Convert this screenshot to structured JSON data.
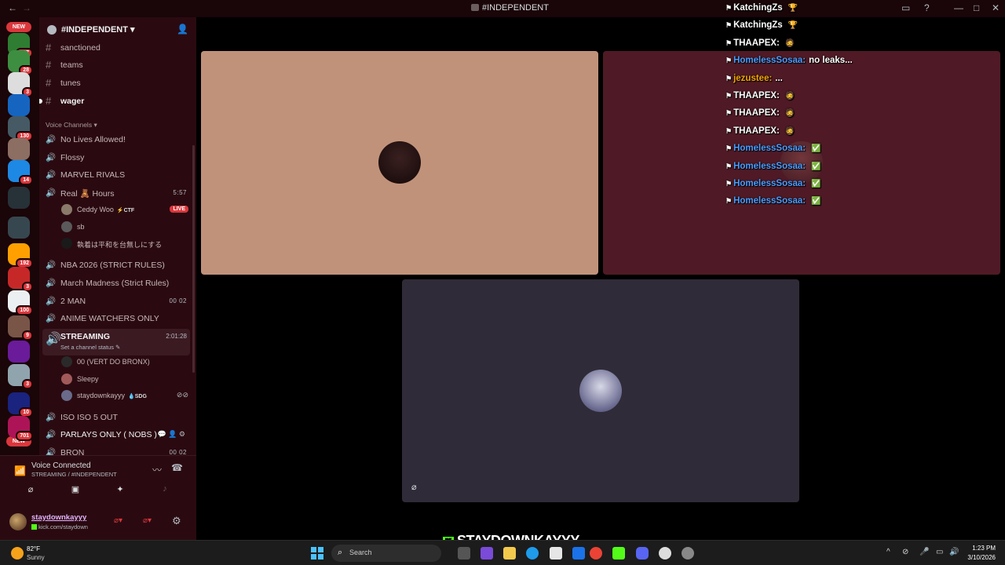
{
  "titlebar": {
    "title": "#INDEPENDENT",
    "back_icon": "arrow-left-icon",
    "forward_icon": "arrow-right-icon"
  },
  "servers": {
    "new_label": "NEW",
    "counts": [
      "437",
      "28",
      "3",
      "",
      "130",
      "",
      "14",
      "",
      "",
      "192",
      "3",
      "100",
      "9",
      "",
      "3",
      "10",
      "701"
    ]
  },
  "guild": {
    "name": "#INDEPENDENT",
    "text_channels": [
      "sanctioned",
      "teams",
      "tunes",
      "wager"
    ],
    "voice_section": "Voice Channels",
    "voice_channels": [
      {
        "name": "No Lives Allowed!"
      },
      {
        "name": "Flossy"
      },
      {
        "name": "MARVEL RIVALS"
      },
      {
        "name": "Real 🧸 Hours",
        "time": "5:57"
      },
      {
        "name": "NBA 2026 (STRICT RULES)"
      },
      {
        "name": "March Madness (Strict Rules)"
      },
      {
        "name": "2 MAN",
        "time": "00 02"
      },
      {
        "name": "ANIME WATCHERS ONLY"
      },
      {
        "name": "STREAMING",
        "time": "2:01:28",
        "status": "Set a channel status"
      },
      {
        "name": "ISO ISO 5 OUT"
      },
      {
        "name": "PARLAYS ONLY ( NOBS )"
      },
      {
        "name": "BRON",
        "time": "00 02"
      }
    ],
    "real_hours_users": [
      {
        "name": "Ceddy Woo",
        "tag": "⚡CTF",
        "live": "LIVE"
      },
      {
        "name": "sb"
      },
      {
        "name": "執着は平和を台無しにする"
      }
    ],
    "streaming_users": [
      {
        "name": "00 (VERT DO BRONX)"
      },
      {
        "name": "Sleepy"
      },
      {
        "name": "staydownkayyy",
        "tag": "💧SDG"
      }
    ]
  },
  "voice": {
    "title": "Voice Connected",
    "subtitle": "STREAMING / #INDEPENDENT"
  },
  "me": {
    "username": "staydownkayyy",
    "status": "kick.com/staydown"
  },
  "chat": [
    {
      "user": "KatchingZs",
      "color": "#ffffff",
      "text": "",
      "emote": "🏆"
    },
    {
      "user": "KatchingZs",
      "color": "#ffffff",
      "text": "",
      "emote": "🏆"
    },
    {
      "user": "THAAPEX:",
      "color": "#ffffff",
      "text": "",
      "emote": "🧔"
    },
    {
      "user": "HomelessSosaa:",
      "color": "#4b9cff",
      "text": "no leaks...",
      "emote": ""
    },
    {
      "user": "jezustee:",
      "color": "#f7a600",
      "text": "...",
      "emote": ""
    },
    {
      "user": "THAAPEX:",
      "color": "#ffffff",
      "text": "",
      "emote": "🧔"
    },
    {
      "user": "THAAPEX:",
      "color": "#ffffff",
      "text": "",
      "emote": "🧔"
    },
    {
      "user": "THAAPEX:",
      "color": "#ffffff",
      "text": "",
      "emote": "🧔"
    },
    {
      "user": "HomelessSosaa:",
      "color": "#4b9cff",
      "text": "",
      "emote": "✅"
    },
    {
      "user": "HomelessSosaa:",
      "color": "#4b9cff",
      "text": "",
      "emote": "✅"
    },
    {
      "user": "HomelessSosaa:",
      "color": "#4b9cff",
      "text": "",
      "emote": "✅"
    },
    {
      "user": "HomelessSosaa:",
      "color": "#4b9cff",
      "text": "",
      "emote": "✅"
    }
  ],
  "streamer_label": "STAYDOWNKAYYY",
  "taskbar": {
    "temp": "82°F",
    "condition": "Sunny",
    "search_placeholder": "Search",
    "time": "1:23 PM",
    "date": "3/10/2026"
  }
}
